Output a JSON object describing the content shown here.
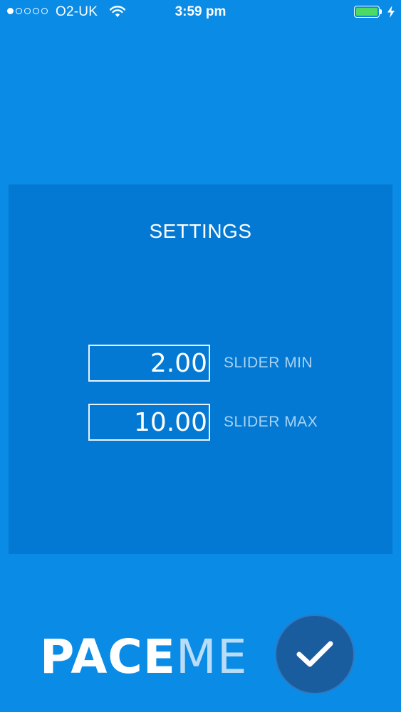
{
  "status_bar": {
    "signal_filled": 1,
    "signal_total": 5,
    "carrier": "O2-UK",
    "time": "3:59 pm",
    "battery_level": 1.0,
    "battery_color": "#4cd964",
    "icons": [
      "wifi-icon",
      "battery-icon",
      "charging-bolt-icon"
    ]
  },
  "settings": {
    "title": "SETTINGS",
    "slider_min": {
      "value": "2.00",
      "label": "SLIDER MIN"
    },
    "slider_max": {
      "value": "10.00",
      "label": "SLIDER MAX"
    }
  },
  "footer": {
    "logo_part1": "PACE",
    "logo_part2": "ME",
    "confirm_icon": "checkmark-icon"
  },
  "colors": {
    "background": "#0a8be6",
    "panel": "#0479d3",
    "confirm_button": "#1a5d9e",
    "label_text": "#a9d3f3"
  }
}
